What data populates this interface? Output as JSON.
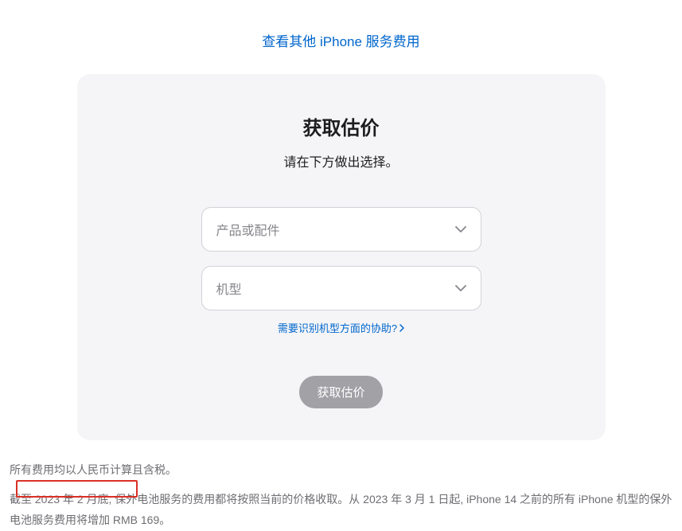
{
  "topLink": {
    "label": "查看其他 iPhone 服务费用"
  },
  "card": {
    "title": "获取估价",
    "subtitle": "请在下方做出选择。",
    "select1": {
      "placeholder": "产品或配件"
    },
    "select2": {
      "placeholder": "机型"
    },
    "helpLink": {
      "label": "需要识别机型方面的协助?"
    },
    "submit": {
      "label": "获取估价"
    }
  },
  "footer": {
    "p1": "所有费用均以人民币计算且含税。",
    "p2": "截至 2023 年 2 月底, 保外电池服务的费用都将按照当前的价格收取。从 2023 年 3 月 1 日起, iPhone 14 之前的所有 iPhone 机型的保外电池服务费用将增加 RMB 169。"
  }
}
